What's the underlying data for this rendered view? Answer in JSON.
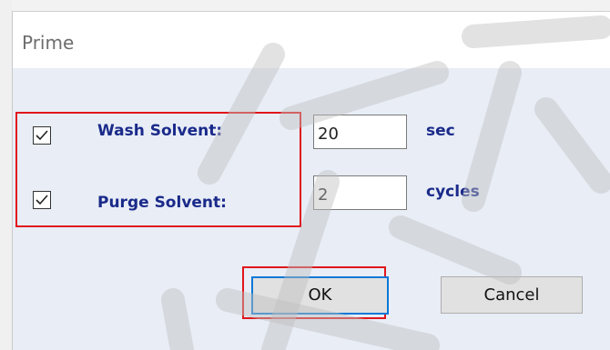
{
  "dialog": {
    "title": "Prime",
    "wash": {
      "label": "Wash Solvent:",
      "value": "20",
      "unit": "sec",
      "checked": true
    },
    "purge": {
      "label": "Purge Solvent:",
      "value": "2",
      "unit": "cycles",
      "checked": true
    },
    "ok_label": "OK",
    "cancel_label": "Cancel"
  },
  "colors": {
    "dialog_bg": "#e8edf6",
    "label_text": "#1a2a8a",
    "highlight": "#e0161b",
    "focus_border": "#0a78d7"
  }
}
